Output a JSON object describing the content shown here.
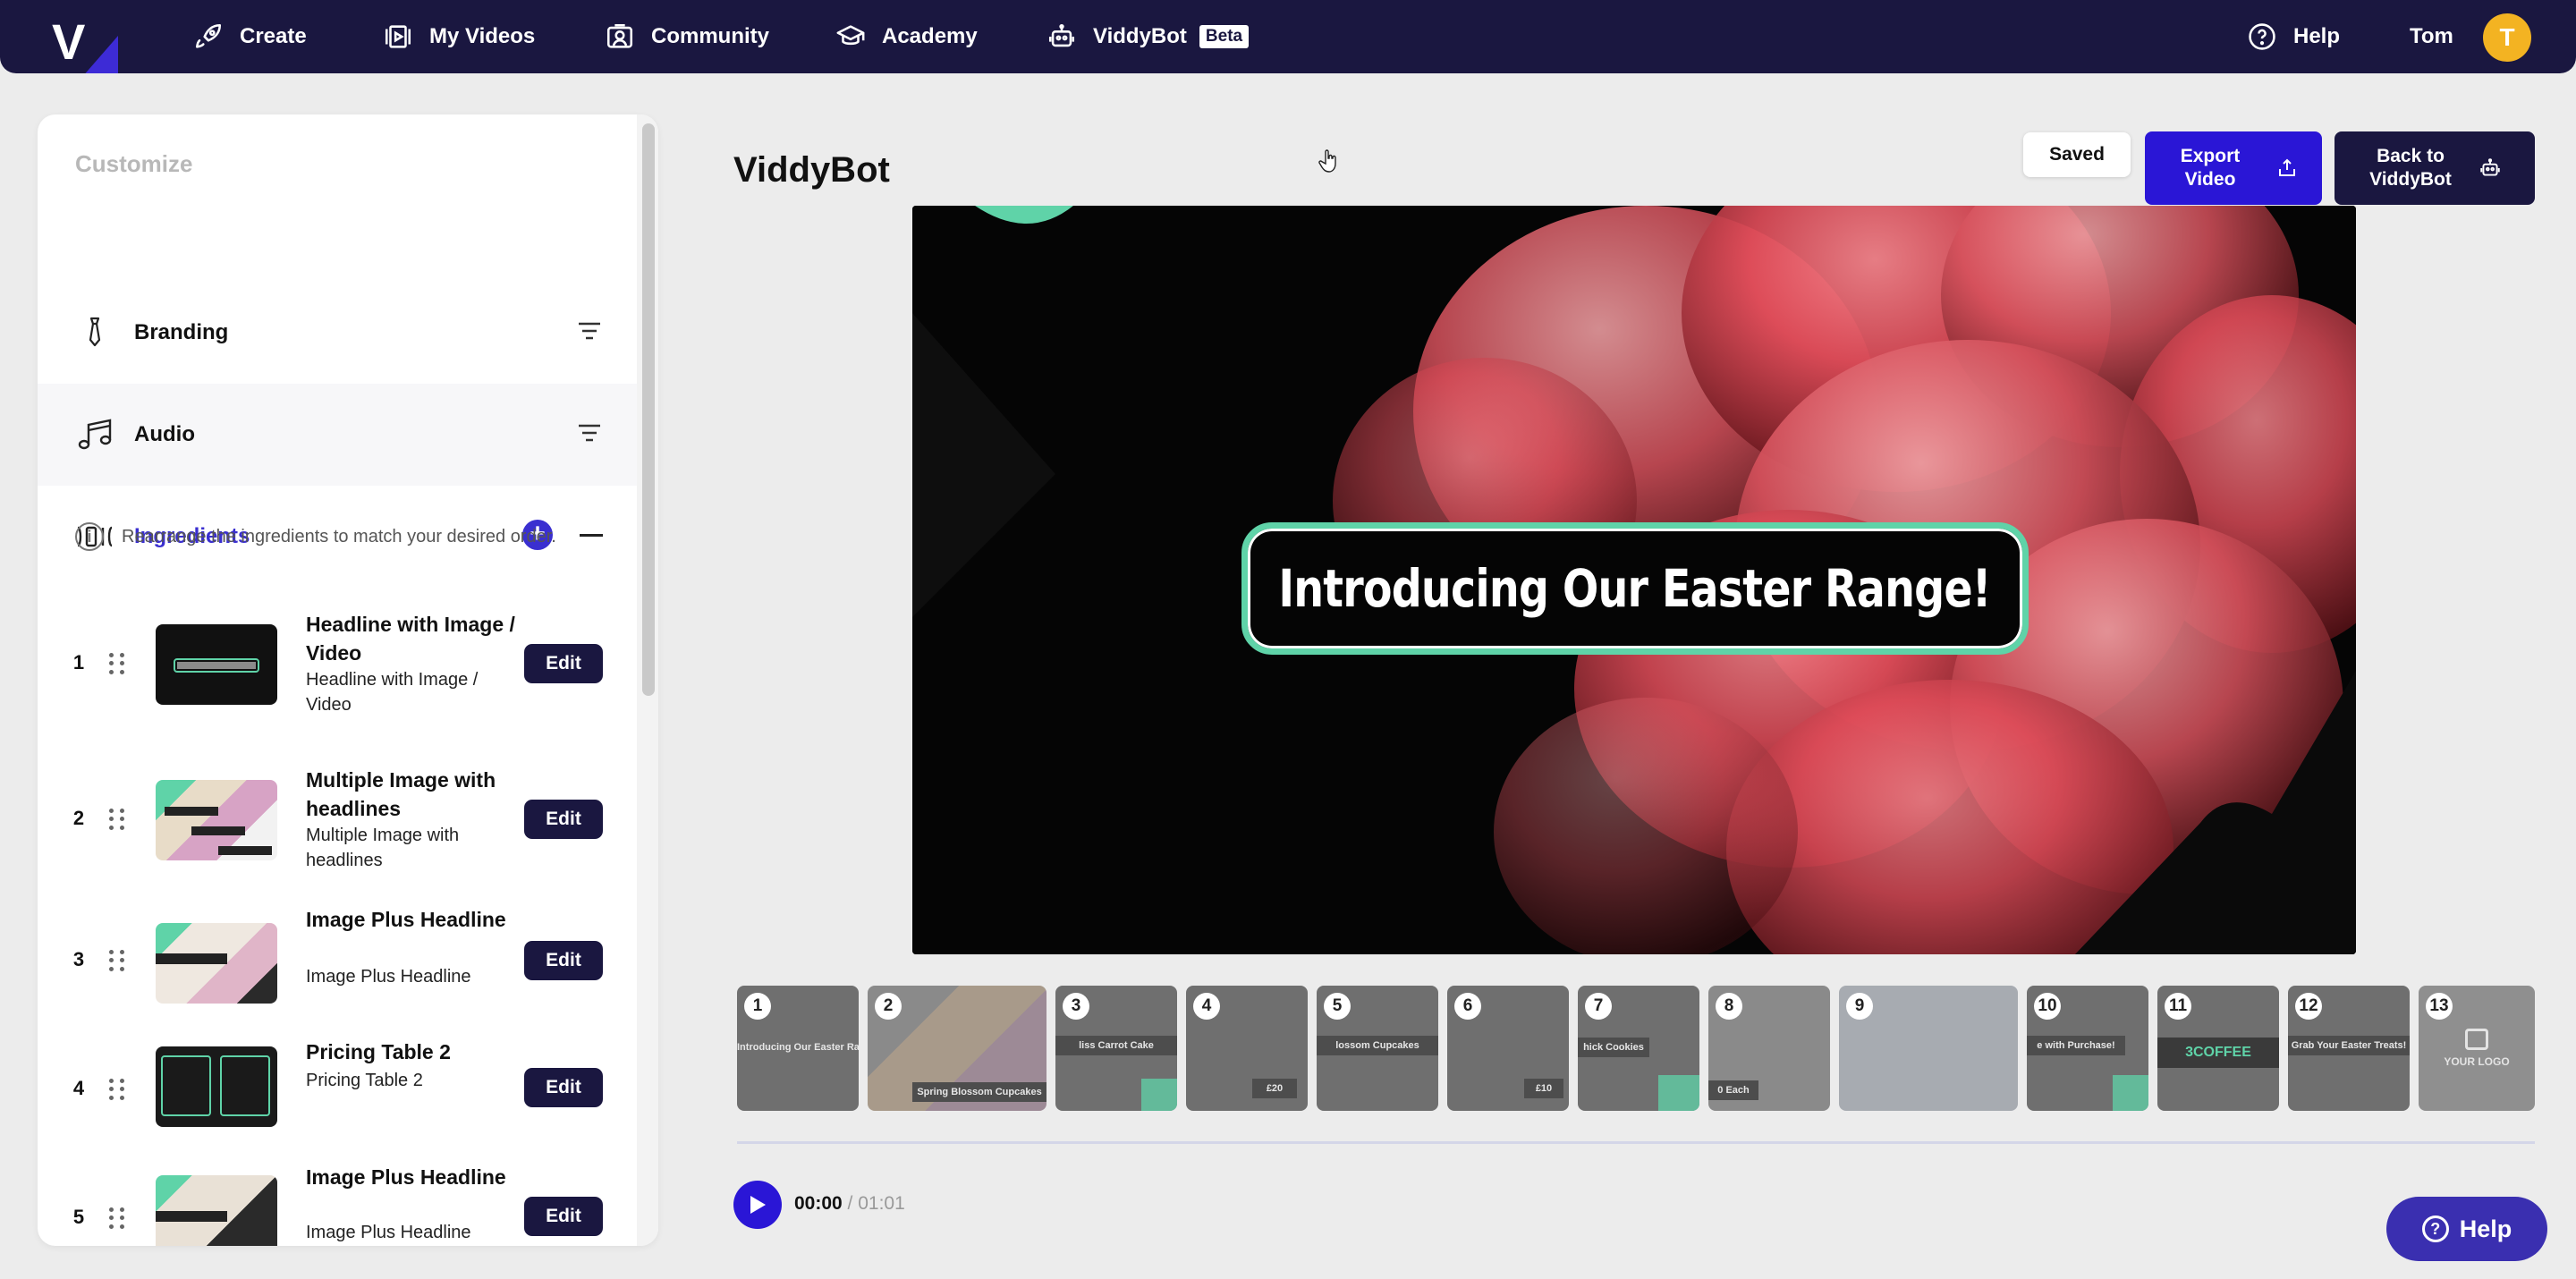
{
  "nav": {
    "logo_letter": "V",
    "items": [
      {
        "label": "Create",
        "icon": "rocket-icon"
      },
      {
        "label": "My Videos",
        "icon": "video-library-icon"
      },
      {
        "label": "Community",
        "icon": "community-icon"
      },
      {
        "label": "Academy",
        "icon": "graduation-cap-icon"
      },
      {
        "label": "ViddyBot",
        "icon": "robot-icon",
        "badge": "Beta"
      }
    ],
    "help_label": "Help",
    "user_name": "Tom",
    "avatar_initial": "T"
  },
  "sidebar": {
    "title": "Customize",
    "sections": [
      {
        "label": "Branding",
        "icon": "tie-icon"
      },
      {
        "label": "Audio",
        "icon": "music-note-icon"
      },
      {
        "label": "Ingredients",
        "icon": "ingredients-icon"
      }
    ],
    "info_text": "Rearrange the ingredients to match your desired order.",
    "edit_label": "Edit",
    "ingredients": [
      {
        "num": "1",
        "title": "Headline with Image / Video",
        "subtitle": "Headline with Image / Video"
      },
      {
        "num": "2",
        "title": "Multiple Image with headlines",
        "subtitle": "Multiple Image with headlines"
      },
      {
        "num": "3",
        "title": "Image Plus Headline",
        "subtitle": "Image Plus Headline"
      },
      {
        "num": "4",
        "title": "Pricing Table 2",
        "subtitle": "Pricing Table 2"
      },
      {
        "num": "5",
        "title": "Image Plus Headline",
        "subtitle": "Image Plus Headline"
      }
    ]
  },
  "main": {
    "title": "ViddyBot",
    "saved_label": "Saved",
    "export_label": "Export Video",
    "back_label": "Back to ViddyBot",
    "preview_headline": "Introducing Our Easter Range!",
    "timeline": [
      {
        "num": "1",
        "caption": "Introducing Our Easter Range!"
      },
      {
        "num": "2",
        "caption": "Spring Blossom Cupcakes"
      },
      {
        "num": "3",
        "caption": "liss Carrot Cake"
      },
      {
        "num": "4",
        "caption": "£20"
      },
      {
        "num": "5",
        "caption": "lossom Cupcakes"
      },
      {
        "num": "6",
        "caption": "£10"
      },
      {
        "num": "7",
        "caption": "hick Cookies"
      },
      {
        "num": "8",
        "caption": "0 Each"
      },
      {
        "num": "9",
        "caption": ""
      },
      {
        "num": "10",
        "caption": "e with Purchase!"
      },
      {
        "num": "11",
        "caption": "3COFFEE"
      },
      {
        "num": "12",
        "caption": "Grab Your Easter Treats!"
      },
      {
        "num": "13",
        "caption": "YOUR LOGO"
      }
    ],
    "time_current": "00:00",
    "time_total": " / 01:01",
    "help_fab_label": "Help"
  },
  "colors": {
    "nav_bg": "#1a1740",
    "accent": "#2a16d6",
    "active_section": "#3a2fd0",
    "headline_border": "#5fd3a8",
    "avatar": "#f3b322"
  }
}
